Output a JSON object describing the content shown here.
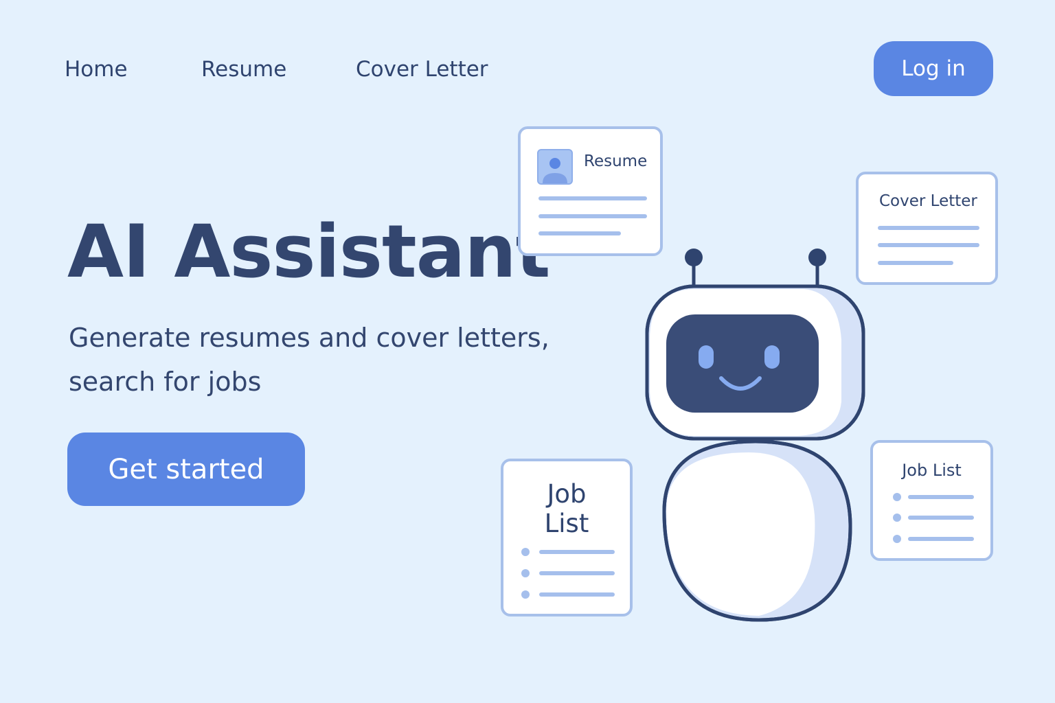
{
  "nav": {
    "home": "Home",
    "resume": "Resume",
    "cover_letter": "Cover Letter",
    "login": "Log in"
  },
  "hero": {
    "title": "AI Assistant",
    "subtitle": "Generate resumes and cover letters, search for jobs",
    "cta": "Get started"
  },
  "cards": {
    "resume": "Resume",
    "cover_letter": "Cover Letter",
    "job_list_left": "Job List",
    "job_list_right": "Job List"
  },
  "colors": {
    "background": "#e4f1fd",
    "accent": "#5a86e3",
    "text": "#2f446f",
    "card_border": "#a7c0ea"
  }
}
